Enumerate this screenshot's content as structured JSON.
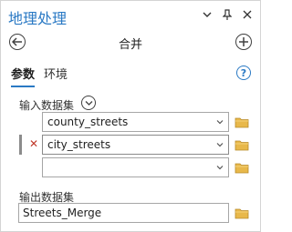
{
  "header": {
    "title": "地理处理",
    "icons": [
      "chevron-down-icon",
      "pin-icon",
      "close-icon"
    ]
  },
  "tool": {
    "title": "合并"
  },
  "tabs": [
    {
      "label": "参数",
      "active": true
    },
    {
      "label": "环境",
      "active": false
    }
  ],
  "input_datasets": {
    "label": "输入数据集",
    "rows": [
      {
        "value": "county_streets"
      },
      {
        "value": "city_streets"
      },
      {
        "value": ""
      }
    ]
  },
  "output_dataset": {
    "label": "输出数据集",
    "value": "Streets_Merge"
  },
  "colors": {
    "accent": "#2a79c4",
    "folder": "#e8b84a",
    "remove": "#c0392b"
  }
}
